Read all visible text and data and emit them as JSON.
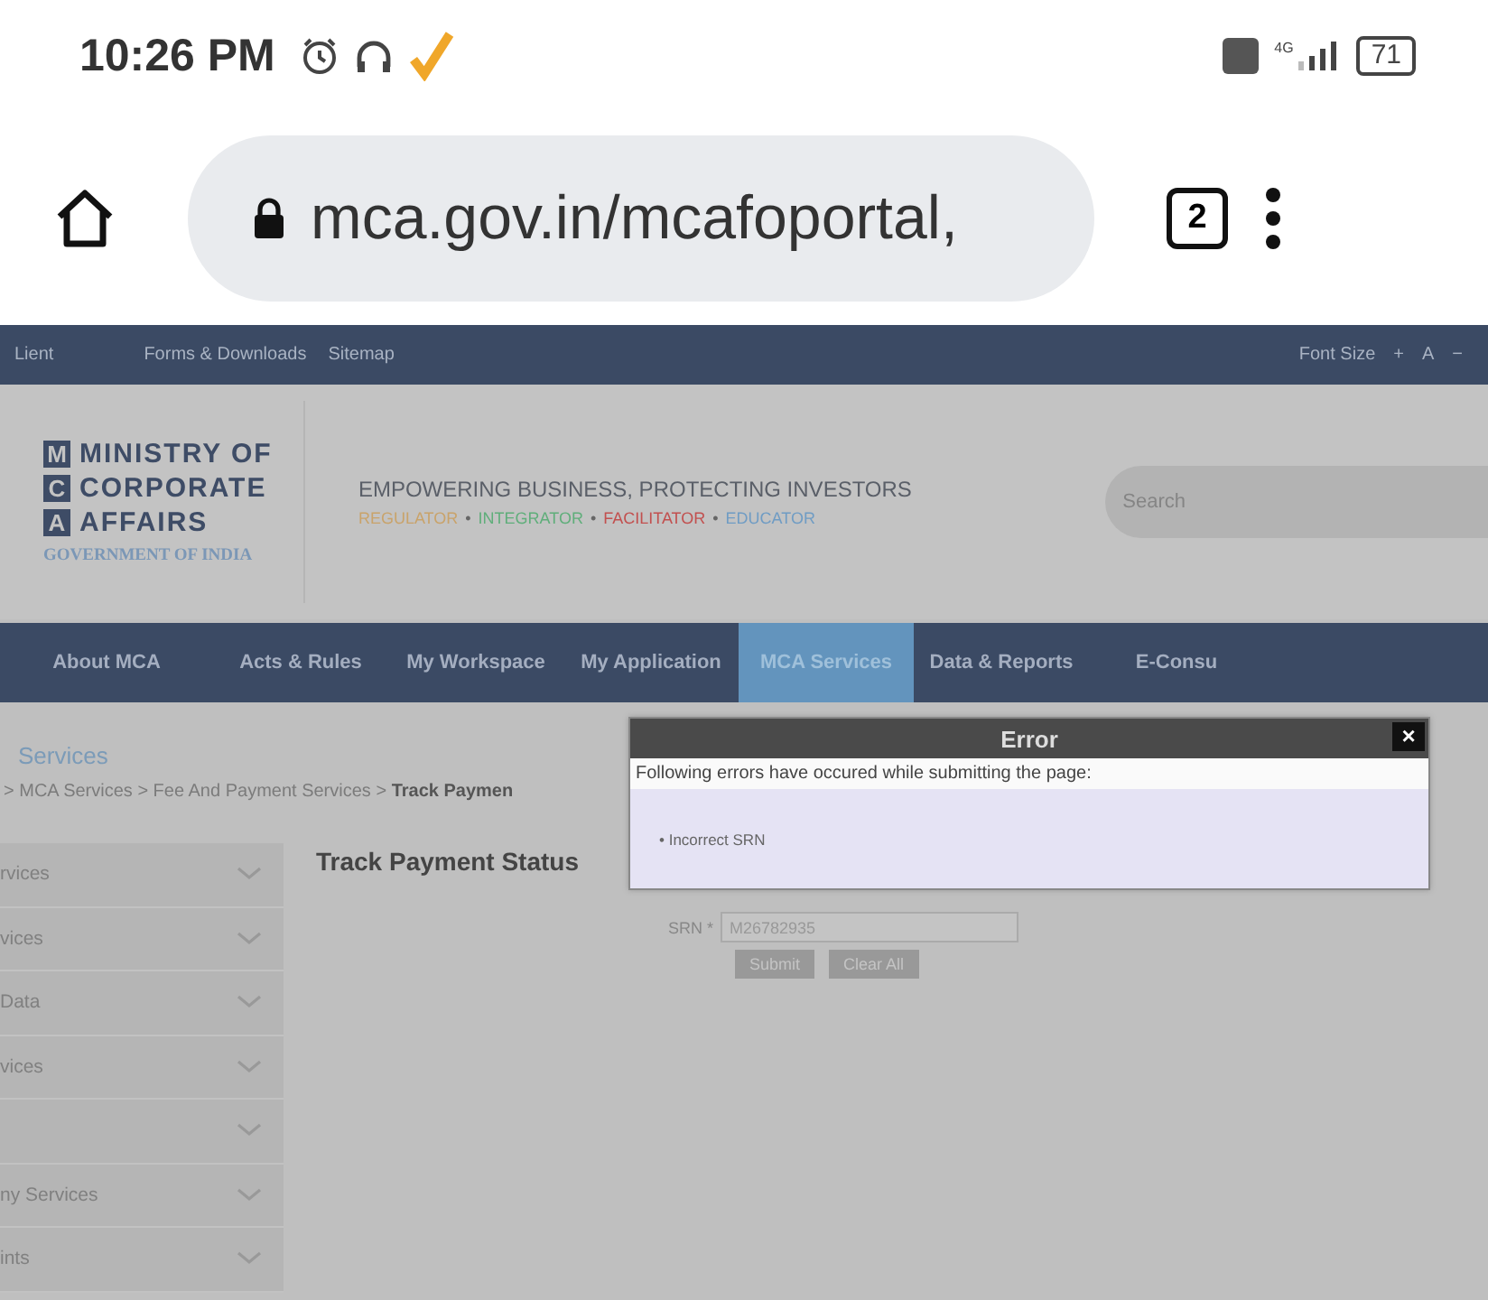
{
  "status_bar": {
    "time": "10:26 PM",
    "battery": "71",
    "network": "4G"
  },
  "browser": {
    "url": "mca.gov.in/mcafoportal,",
    "tab_count": "2"
  },
  "top_bar": {
    "left": "Lient",
    "links": [
      "Forms & Downloads",
      "Sitemap"
    ],
    "font_size": {
      "label": "Font Size",
      "buttons": [
        "+",
        "A",
        "−"
      ]
    }
  },
  "header": {
    "logo": {
      "letters": [
        "M",
        "C",
        "A"
      ],
      "words": [
        "MINISTRY OF",
        "CORPORATE",
        "AFFAIRS"
      ],
      "subtitle": "GOVERNMENT OF INDIA"
    },
    "tagline": "EMPOWERING BUSINESS, PROTECTING INVESTORS",
    "role_separator": "•",
    "roles": [
      {
        "text": "REGULATOR",
        "color": "#c9a36a"
      },
      {
        "text": "INTEGRATOR",
        "color": "#5fae7a"
      },
      {
        "text": "FACILITATOR",
        "color": "#c2504f"
      },
      {
        "text": "EDUCATOR",
        "color": "#6f9cc4"
      }
    ],
    "search": {
      "placeholder": "Search"
    }
  },
  "nav": [
    {
      "label": "About MCA",
      "selected": false
    },
    {
      "label": "Acts & Rules",
      "selected": false
    },
    {
      "label": "My Workspace",
      "selected": false
    },
    {
      "label": "My Application",
      "selected": false
    },
    {
      "label": "MCA Services",
      "selected": true
    },
    {
      "label": "Data & Reports",
      "selected": false
    },
    {
      "label": "E-Consu",
      "selected": false
    }
  ],
  "section_title": "Services",
  "breadcrumb": [
    "> MCA Services > Fee And Payment Services > ",
    "Track Paymen"
  ],
  "sidebar": {
    "items": [
      {
        "kind": "labeled",
        "label": "rvices"
      },
      {
        "kind": "labeled",
        "label": "vices"
      },
      {
        "kind": "labeled",
        "label": "Data"
      },
      {
        "kind": "labeled",
        "label": "vices"
      },
      {
        "kind": "blank"
      },
      {
        "kind": "labeled",
        "label": "ny Services"
      },
      {
        "kind": "labeled",
        "label": "ints"
      }
    ]
  },
  "form": {
    "title": "Track Payment Status",
    "srn": {
      "label": "SRN *",
      "value": "M26782935"
    },
    "buttons": [
      "Submit",
      "Clear All"
    ]
  },
  "dialog": {
    "title": "Error",
    "close": "×",
    "message": "Following errors have occured while submitting the page:",
    "errors": [
      "• Incorrect SRN"
    ]
  }
}
